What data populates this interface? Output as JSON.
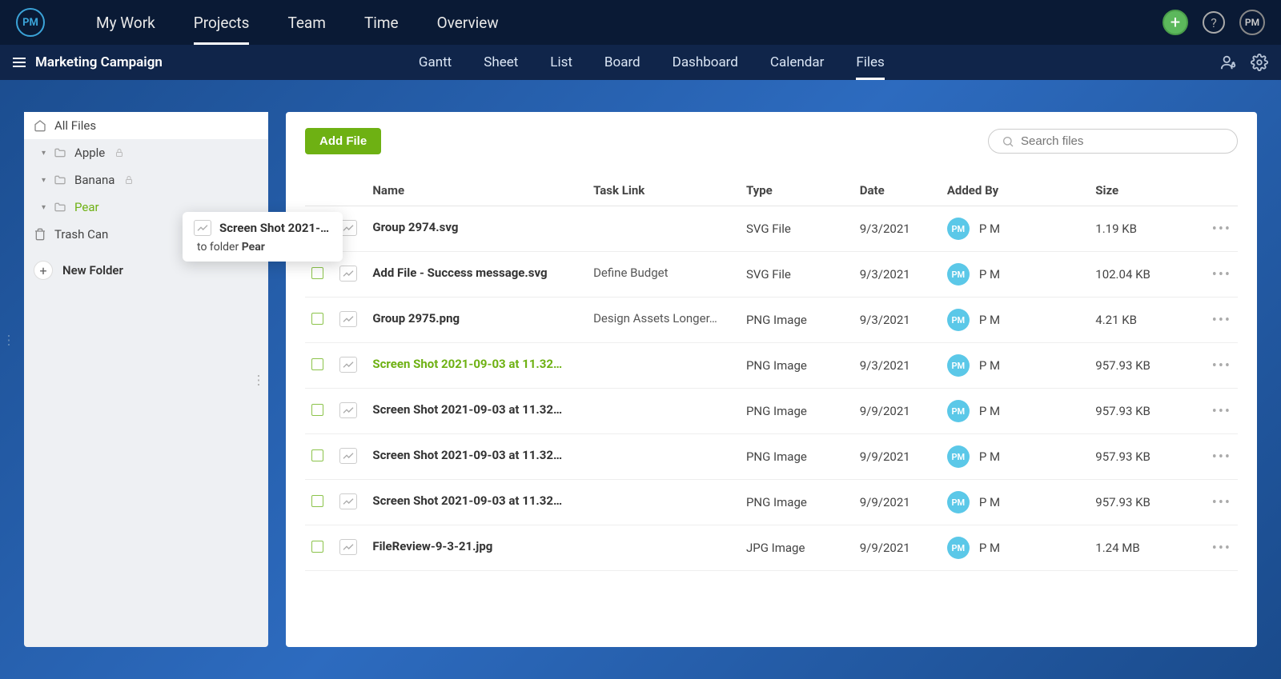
{
  "logo": "PM",
  "topnav": [
    "My Work",
    "Projects",
    "Team",
    "Time",
    "Overview"
  ],
  "topnav_active": 1,
  "topright_avatar": "PM",
  "project_title": "Marketing Campaign",
  "subnav_tabs": [
    "Gantt",
    "Sheet",
    "List",
    "Board",
    "Dashboard",
    "Calendar",
    "Files"
  ],
  "subnav_active": 6,
  "sidebar": {
    "all_files": "All Files",
    "folders": [
      {
        "label": "Apple",
        "locked": true,
        "active": false
      },
      {
        "label": "Banana",
        "locked": true,
        "active": false
      },
      {
        "label": "Pear",
        "locked": false,
        "active": true
      }
    ],
    "trash": "Trash Can",
    "new_folder": "New Folder"
  },
  "drag_tooltip": {
    "filename": "Screen Shot 2021-…",
    "prefix": "to folder ",
    "target": "Pear"
  },
  "toolbar": {
    "add_file": "Add File",
    "search_placeholder": "Search files"
  },
  "columns": [
    "Name",
    "Task Link",
    "Type",
    "Date",
    "Added By",
    "Size"
  ],
  "rows": [
    {
      "name": "Group 2974.svg",
      "task": "",
      "type": "SVG File",
      "date": "9/3/2021",
      "by_initials": "PM",
      "by_name": "P M",
      "size": "1.19 KB",
      "dragging": false
    },
    {
      "name": "Add File - Success message.svg",
      "task": "Define Budget",
      "type": "SVG File",
      "date": "9/3/2021",
      "by_initials": "PM",
      "by_name": "P M",
      "size": "102.04 KB",
      "dragging": false
    },
    {
      "name": "Group 2975.png",
      "task": "Design Assets Longer…",
      "type": "PNG Image",
      "date": "9/3/2021",
      "by_initials": "PM",
      "by_name": "P M",
      "size": "4.21 KB",
      "dragging": false
    },
    {
      "name": "Screen Shot 2021-09-03 at 11.32…",
      "task": "",
      "type": "PNG Image",
      "date": "9/3/2021",
      "by_initials": "PM",
      "by_name": "P M",
      "size": "957.93 KB",
      "dragging": true
    },
    {
      "name": "Screen Shot 2021-09-03 at 11.32…",
      "task": "",
      "type": "PNG Image",
      "date": "9/9/2021",
      "by_initials": "PM",
      "by_name": "P M",
      "size": "957.93 KB",
      "dragging": false
    },
    {
      "name": "Screen Shot 2021-09-03 at 11.32…",
      "task": "",
      "type": "PNG Image",
      "date": "9/9/2021",
      "by_initials": "PM",
      "by_name": "P M",
      "size": "957.93 KB",
      "dragging": false
    },
    {
      "name": "Screen Shot 2021-09-03 at 11.32…",
      "task": "",
      "type": "PNG Image",
      "date": "9/9/2021",
      "by_initials": "PM",
      "by_name": "P M",
      "size": "957.93 KB",
      "dragging": false
    },
    {
      "name": "FileReview-9-3-21.jpg",
      "task": "",
      "type": "JPG Image",
      "date": "9/9/2021",
      "by_initials": "PM",
      "by_name": "P M",
      "size": "1.24 MB",
      "dragging": false
    }
  ]
}
